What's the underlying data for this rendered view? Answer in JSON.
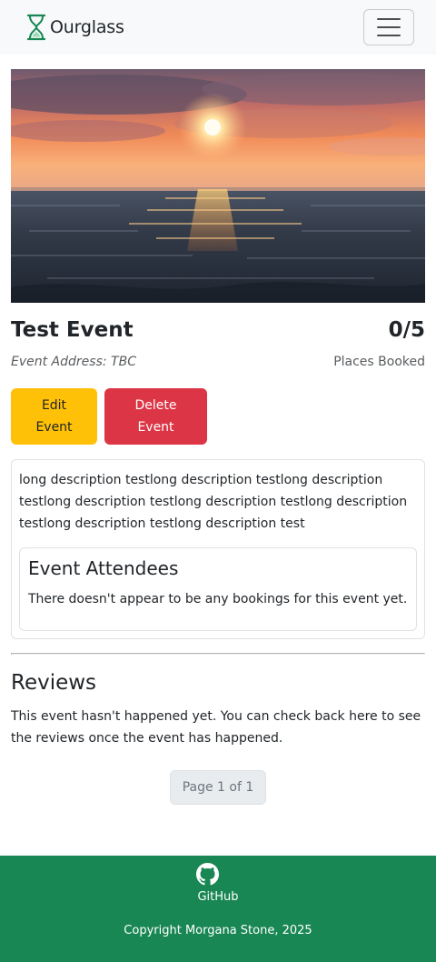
{
  "navbar": {
    "brand": "Ourglass",
    "brand_icon": "hourglass-icon",
    "menu_icon": "hamburger-menu-icon"
  },
  "hero": {
    "image": "sunset-over-ocean-photo"
  },
  "event": {
    "title": "Test Event",
    "places_count": "0/5",
    "places_label": "Places Booked",
    "address": "Event Address: TBC",
    "edit_label_1": "Edit",
    "edit_label_2": "Event",
    "delete_label_1": "Delete",
    "delete_label_2": "Event",
    "description": "long description testlong description testlong description testlong description testlong description testlong description testlong description testlong description test"
  },
  "attendees": {
    "title": "Event Attendees",
    "empty_text": "There doesn't appear to be any bookings for this event yet."
  },
  "reviews": {
    "title": "Reviews",
    "text": "This event hasn't happened yet. You can check back here to see the reviews once the event has happened."
  },
  "pagination": {
    "label": "Page 1 of 1"
  },
  "footer": {
    "github_icon": "github-icon",
    "github_label": "GitHub",
    "copyright": "Copyright Morgana Stone, 2025"
  },
  "colors": {
    "navbar_bg": "#f8f9fa",
    "edit_button": "#ffc107",
    "delete_button": "#dc3545",
    "footer_bg": "#198754",
    "brand_icon": "#198754"
  }
}
